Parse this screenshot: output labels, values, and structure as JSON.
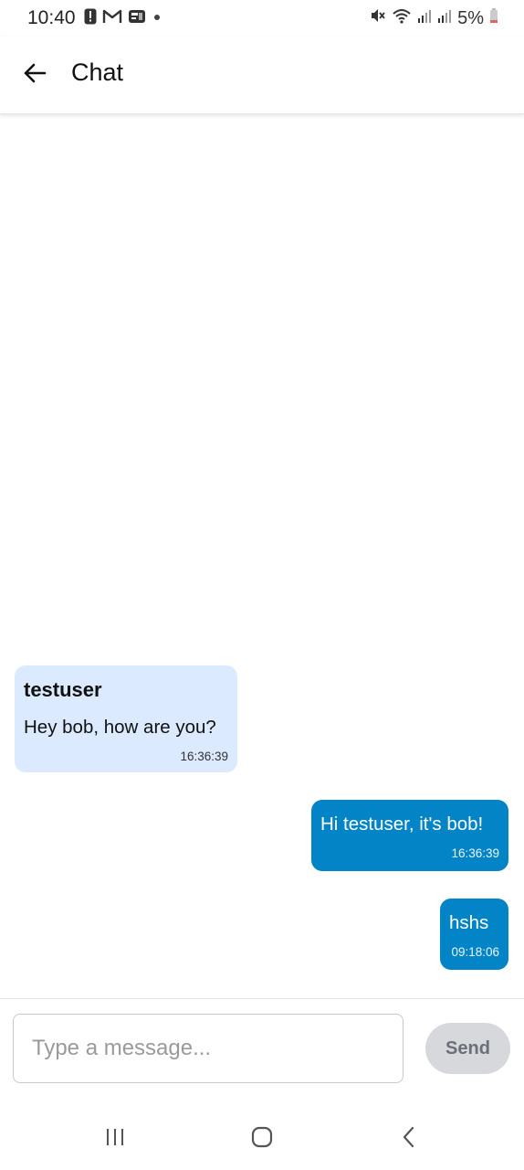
{
  "status_bar": {
    "time": "10:40",
    "battery_text": "5%",
    "left_icons": [
      "alert-icon",
      "gmail-icon",
      "news-icon",
      "dot-icon"
    ],
    "right_icons": [
      "mute-icon",
      "wifi-icon",
      "signal-icon",
      "signal-icon",
      "battery-icon"
    ]
  },
  "app_bar": {
    "title": "Chat",
    "back_icon": "arrow-left-icon"
  },
  "messages": [
    {
      "direction": "incoming",
      "sender": "testuser",
      "text": "Hey bob, how are you?",
      "time": "16:36:39"
    },
    {
      "direction": "outgoing",
      "text": "Hi testuser, it's bob!",
      "time": "16:36:39"
    },
    {
      "direction": "outgoing",
      "text": "hshs",
      "time": "09:18:06"
    }
  ],
  "composer": {
    "placeholder": "Type a message...",
    "value": "",
    "send_label": "Send"
  },
  "nav_bar": {
    "icons": [
      "recent-apps-icon",
      "home-icon",
      "back-icon"
    ]
  },
  "colors": {
    "incoming_bubble": "#dbeafe",
    "outgoing_bubble": "#0284c7",
    "send_button_disabled": "#d6d8dc"
  }
}
